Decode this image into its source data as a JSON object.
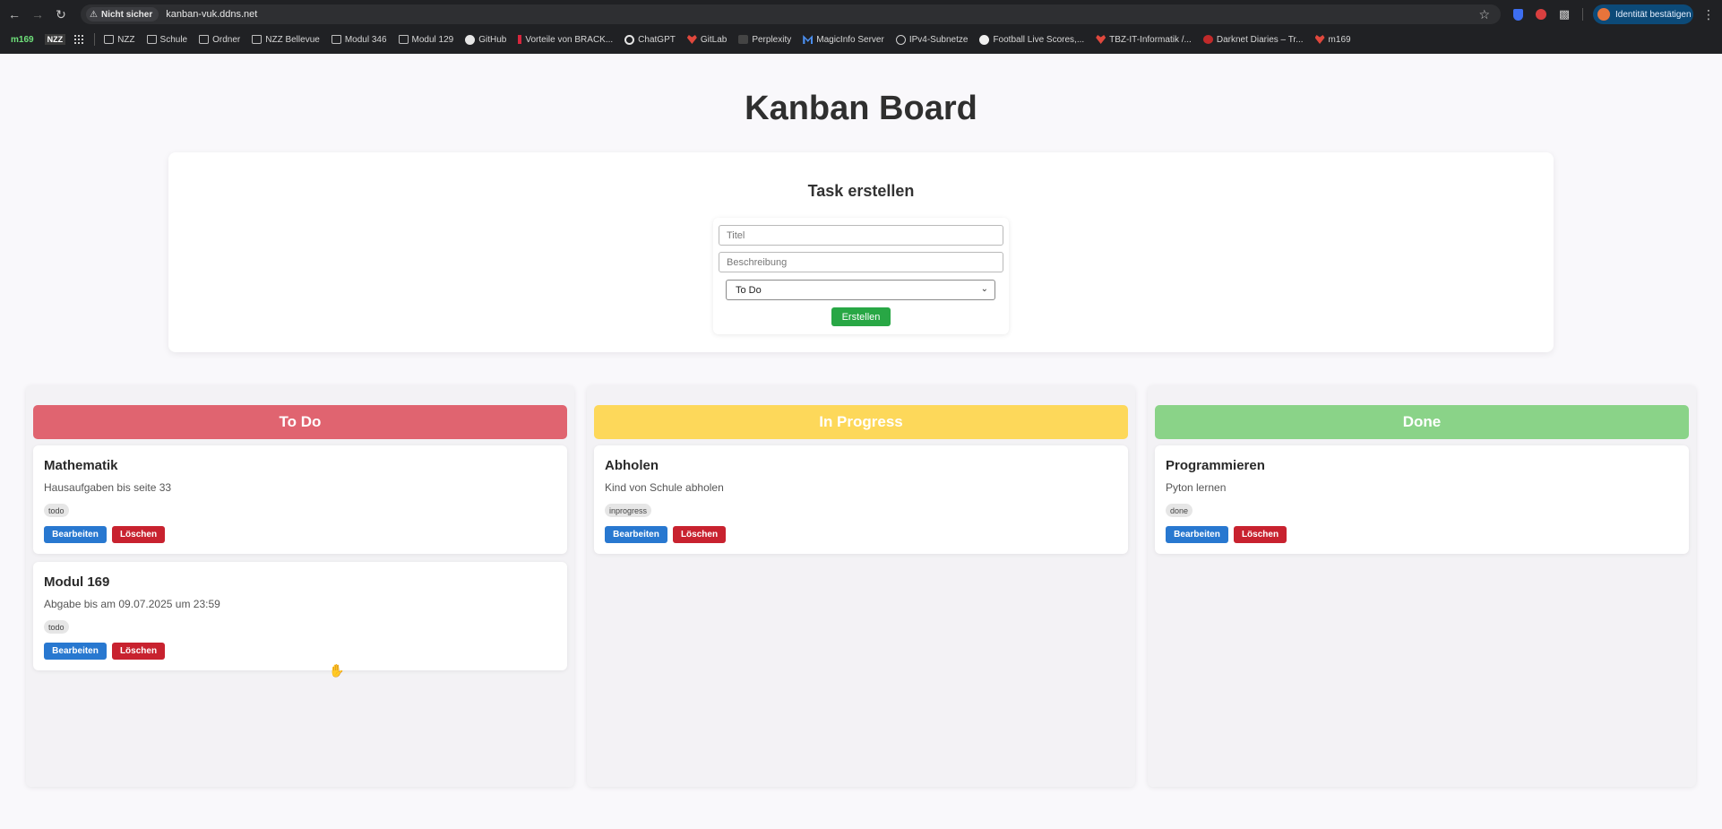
{
  "browser": {
    "security_label": "Nicht sicher",
    "url": "kanban-vuk.ddns.net",
    "identity_label": "Identität bestätigen",
    "bookmarks": {
      "m169": "m169",
      "nzz_badge": "NZZ",
      "items": [
        "NZZ",
        "Schule",
        "Ordner",
        "NZZ Bellevue",
        "Modul 346",
        "Modul 129",
        "GitHub",
        "Vorteile von BRACK...",
        "ChatGPT",
        "GitLab",
        "Perplexity",
        "MagicInfo Server",
        "IPv4-Subnetze",
        "Football Live Scores,...",
        "TBZ-IT-Informatik /...",
        "Darknet Diaries – Tr...",
        "m169"
      ]
    }
  },
  "page": {
    "title": "Kanban Board"
  },
  "form": {
    "title": "Task erstellen",
    "title_placeholder": "Titel",
    "description_placeholder": "Beschreibung",
    "status_selected": "To Do",
    "submit_label": "Erstellen"
  },
  "columns": [
    {
      "title": "To Do",
      "color": "#e06470",
      "cards": [
        {
          "title": "Mathematik",
          "description": "Hausaufgaben bis seite 33",
          "tag": "todo",
          "edit_label": "Bearbeiten",
          "delete_label": "Löschen"
        },
        {
          "title": "Modul 169",
          "description": "Abgabe bis am 09.07.2025 um 23:59",
          "tag": "todo",
          "edit_label": "Bearbeiten",
          "delete_label": "Löschen"
        }
      ]
    },
    {
      "title": "In Progress",
      "color": "#fdd85a",
      "cards": [
        {
          "title": "Abholen",
          "description": "Kind von Schule abholen",
          "tag": "inprogress",
          "edit_label": "Bearbeiten",
          "delete_label": "Löschen"
        }
      ]
    },
    {
      "title": "Done",
      "color": "#8ad388",
      "cards": [
        {
          "title": "Programmieren",
          "description": "Pyton lernen",
          "tag": "done",
          "edit_label": "Bearbeiten",
          "delete_label": "Löschen"
        }
      ]
    }
  ],
  "colors": {
    "create_button": "#28a745",
    "edit_button": "#2878d0",
    "delete_button": "#c8222f"
  }
}
